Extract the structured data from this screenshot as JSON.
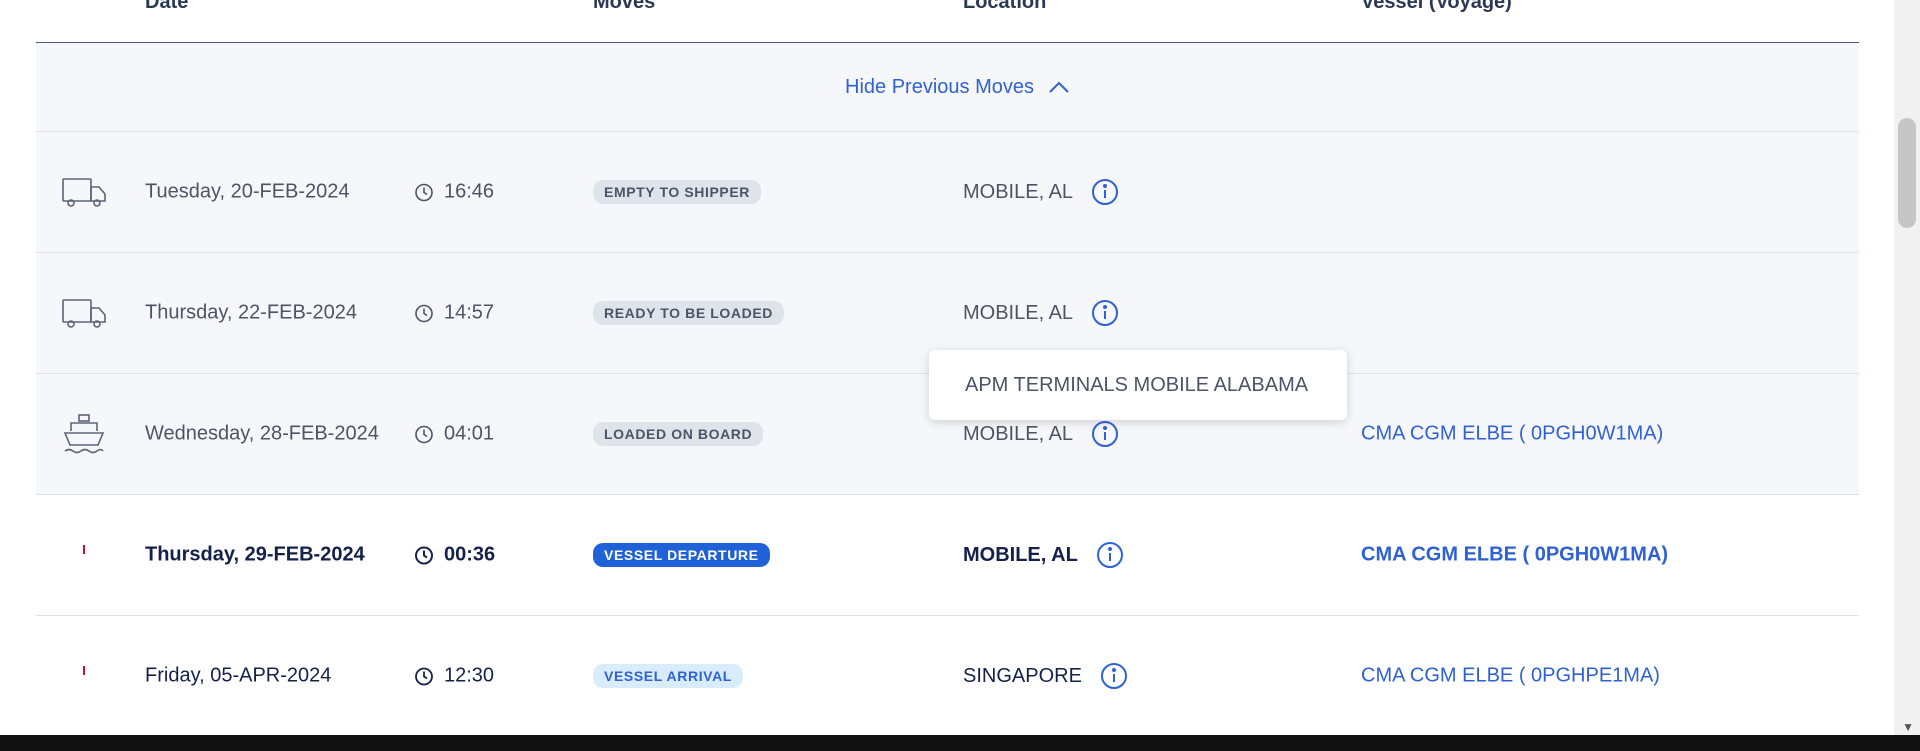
{
  "columns": {
    "date": "Date",
    "moves": "Moves",
    "location": "Location",
    "vessel": "Vessel (Voyage)"
  },
  "toggle": {
    "label": "Hide Previous Moves"
  },
  "moves": [
    {
      "icon": "truck-icon",
      "date": "Tuesday, 20-FEB-2024",
      "time": "16:46",
      "status": "EMPTY TO SHIPPER",
      "location": "MOBILE, AL",
      "vessel": ""
    },
    {
      "icon": "truck-icon",
      "date": "Thursday, 22-FEB-2024",
      "time": "14:57",
      "status": "READY TO BE LOADED",
      "location": "MOBILE, AL",
      "vessel": ""
    },
    {
      "icon": "ship-icon",
      "date": "Wednesday, 28-FEB-2024",
      "time": "04:01",
      "status": "LOADED ON BOARD",
      "location": "MOBILE, AL",
      "vessel": "CMA CGM ELBE ( 0PGH0W1MA)"
    },
    {
      "icon": "ship-icon",
      "date": "Thursday, 29-FEB-2024",
      "time": "00:36",
      "status": "VESSEL DEPARTURE",
      "location": "MOBILE, AL",
      "vessel": "CMA CGM ELBE ( 0PGH0W1MA)"
    },
    {
      "icon": "ship-icon",
      "date": "Friday, 05-APR-2024",
      "time": "12:30",
      "status": "VESSEL ARRIVAL",
      "location": "SINGAPORE",
      "vessel": "CMA CGM ELBE ( 0PGHPE1MA)"
    }
  ],
  "tooltip": {
    "text": "APM TERMINALS MOBILE ALABAMA"
  },
  "colors": {
    "accent": "#2f61d6",
    "departure_badge": "#1f62d8",
    "arrival_badge": "#d9ecfb",
    "ship_red": "#c8102e"
  }
}
